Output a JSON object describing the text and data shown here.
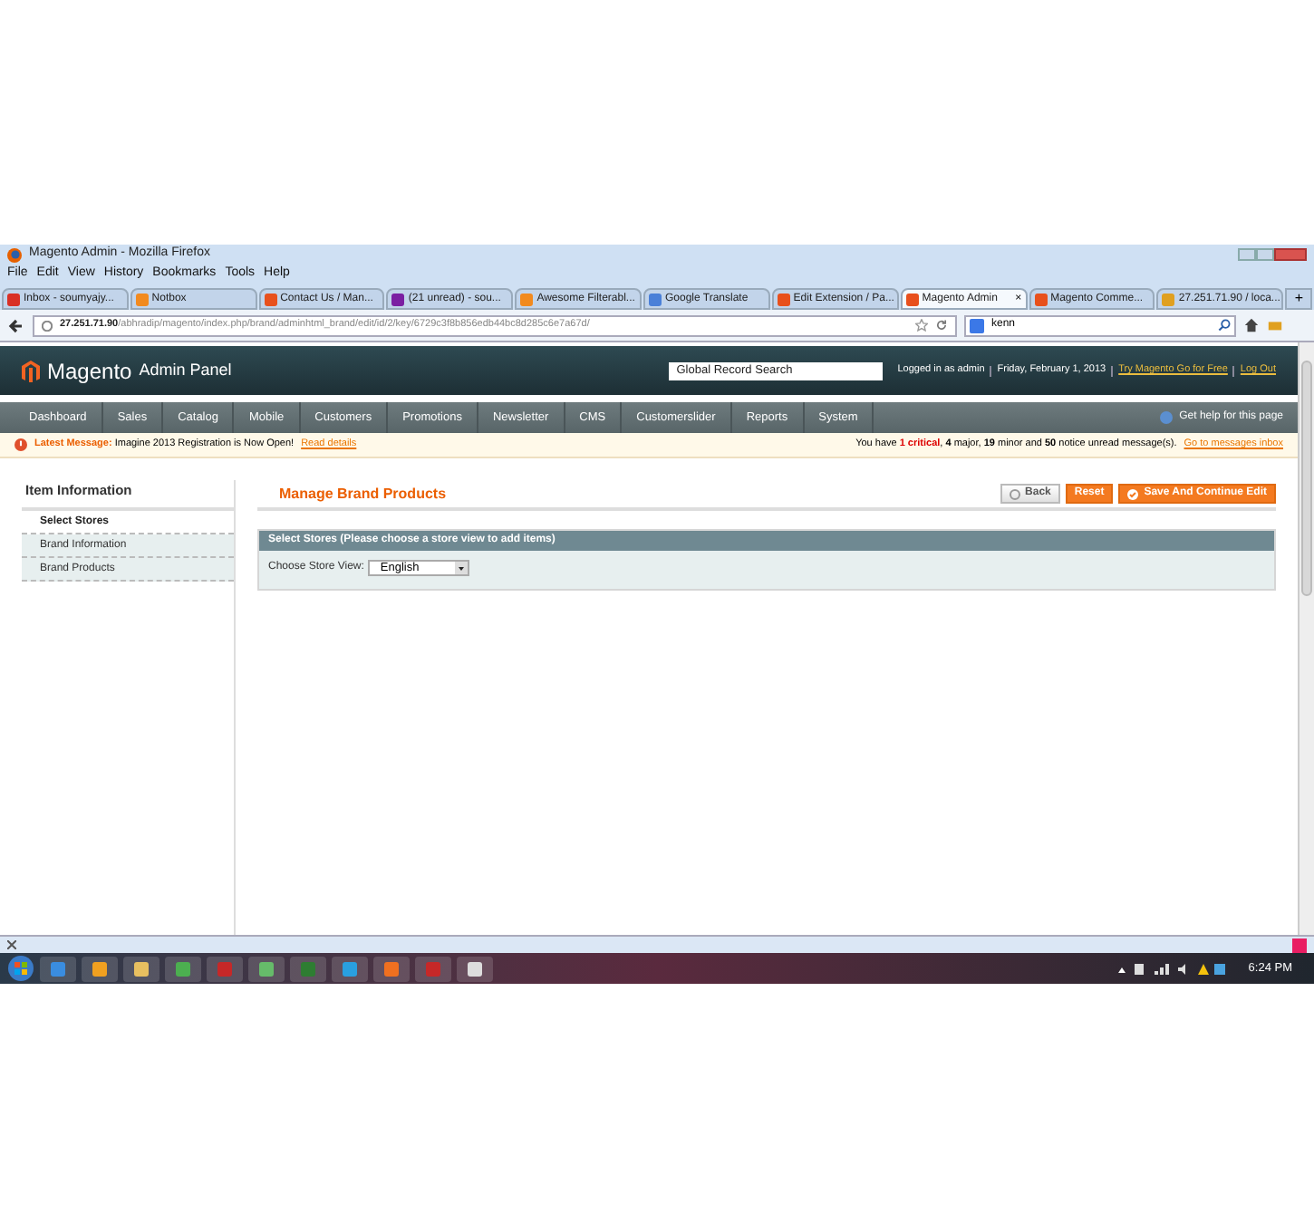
{
  "window": {
    "title": "Magento Admin - Mozilla Firefox"
  },
  "menu": [
    "File",
    "Edit",
    "View",
    "History",
    "Bookmarks",
    "Tools",
    "Help"
  ],
  "tabs": [
    {
      "label": "Inbox - soumyajy...",
      "selected": false,
      "color": "#d93025"
    },
    {
      "label": "Notbox",
      "selected": false,
      "color": "#f28a1e"
    },
    {
      "label": "Contact Us / Man...",
      "selected": false,
      "color": "#e8501c"
    },
    {
      "label": "(21 unread) - sou...",
      "selected": false,
      "color": "#7b1fa2"
    },
    {
      "label": "Awesome Filterabl...",
      "selected": false,
      "color": "#f28a1e"
    },
    {
      "label": "Google Translate",
      "selected": false,
      "color": "#4a80d8"
    },
    {
      "label": "Edit Extension / Pa...",
      "selected": false,
      "color": "#e8501c"
    },
    {
      "label": "Magento Admin",
      "selected": true,
      "color": "#e8501c"
    },
    {
      "label": "Magento Comme...",
      "selected": false,
      "color": "#e8501c"
    },
    {
      "label": "27.251.71.90 / loca...",
      "selected": false,
      "color": "#e0a020"
    }
  ],
  "new_tab": "+",
  "close_tab": "×",
  "address": {
    "host": "27.251.71.90",
    "path": "/abhradip/magento/index.php/brand/adminhtml_brand/edit/id/2/key/6729c3f8b856edb44bc8d285c6e7a67d/"
  },
  "web_search": {
    "value": "kenn"
  },
  "header": {
    "logo": "Magento",
    "logo_suffix": "Admin Panel",
    "search": {
      "placeholder": "Global Record Search"
    },
    "user": "Logged in as admin",
    "date": "Friday, February 1, 2013",
    "links": [
      "Try Magento Go for Free",
      "Log Out"
    ]
  },
  "nav": [
    "Dashboard",
    "Sales",
    "Catalog",
    "Mobile",
    "Customers",
    "Promotions",
    "Newsletter",
    "CMS",
    "Customerslider",
    "Reports",
    "System"
  ],
  "help": "Get help for this page",
  "message": {
    "label": "Latest Message:",
    "text": "Imagine 2013 Registration is Now Open!",
    "link": "Read details",
    "summary": "You have **1 critical**, **4** major, **19** minor and **50** notice unread message(s).",
    "inbox_link": "Go to messages inbox"
  },
  "sidebar": {
    "title": "Item Information",
    "items": [
      {
        "label": "Select Stores",
        "selected": true
      },
      {
        "label": "Brand Information",
        "selected": false
      },
      {
        "label": "Brand Products",
        "selected": false
      }
    ]
  },
  "page_title": "Manage Brand Products",
  "buttons": [
    {
      "label": "Back",
      "kind": "back"
    },
    {
      "label": "Reset",
      "kind": "reset"
    },
    {
      "label": "Save And Continue Edit",
      "kind": "save"
    }
  ],
  "fieldset": {
    "title": "Select Stores (Please choose a store view to add items)",
    "field_label": "Choose Store View:",
    "value": "English"
  },
  "taskbar": {
    "clock": "6:24 PM"
  }
}
